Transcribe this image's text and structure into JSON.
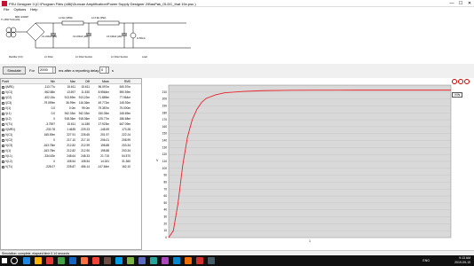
{
  "window": {
    "title": "PSU Designer II  (C:\\Program Files (x86)\\Duncan Amplification\\Power Supply Designer 2\\BasPak_OLDC_that 15x.psu )",
    "controls": [
      "—",
      "☐",
      "✕"
    ]
  },
  "menu": [
    "File",
    "Options",
    "Help"
  ],
  "schematic": {
    "transformer": "MR1 1N4007",
    "tx_label": "Tx 165V\n5.0A\n(2Ω)",
    "c1": "C1 220uF\n(2Ω)",
    "c2": "C2 220uF\n(2Ω)",
    "c3": "C3 440uF\n(2Ω)",
    "l1": "L1 6H (105Ω)",
    "l2": "L2 6.9H (35Ω)",
    "load": "I1\n65mA",
    "captions": [
      "Rectifier (0.0)",
      "LC Filter",
      "LC Filter Section",
      "LC Filter Section",
      "Load"
    ]
  },
  "toolbar": {
    "simulate": "Simulate",
    "for_label": "For",
    "for_value": "2000",
    "ms_label": "ms   after a reporting delay of",
    "delay_value": "0",
    "s_label": "s"
  },
  "table": {
    "headers": [
      "Plot/#",
      "Min",
      "Max",
      "Diff",
      "Mean",
      "RMS"
    ],
    "rows": [
      [
        "I(MR1)",
        "-113.77u",
        "15.611",
        "15.611",
        "96.097m",
        "540.97m"
      ],
      [
        "V(C1)",
        "-962.88n",
        "13.597",
        "11.530",
        "8.9564m",
        "590.59m"
      ],
      [
        "I(C2)",
        "-402.15u",
        "913.59m",
        "913.22m",
        "-71.889m",
        "77.964m"
      ],
      [
        "I(C3)",
        "-79.099m",
        "36.99m",
        "116.36m",
        "49.772m",
        "145.92m"
      ],
      [
        "V(1)",
        "0.0",
        "0.0m",
        "99.0m",
        "79.387m",
        "79.000m"
      ],
      [
        "I(L1)",
        "0.0",
        "942.33m",
        "942.33m",
        "150.05m",
        "245.69m"
      ],
      [
        "I(L2)",
        "0",
        "918.36m",
        "918.36m",
        "125.77m",
        "186.68m"
      ],
      [
        "V(T1)",
        "-3.7597",
        "15.611",
        "14.185",
        "17.923m",
        "647.09m"
      ],
      [
        "V(MR1)",
        "-230.78",
        "1.4635",
        "229.23",
        "-148.59",
        "173.28"
      ],
      [
        "V(C1)",
        "165.59m",
        "227.91",
        "226.65",
        "201.97",
        "222.24"
      ],
      [
        "V(C2)",
        "0",
        "217.10",
        "217.10",
        "206.01",
        "208.99"
      ],
      [
        "V(C3)",
        "-163.78m",
        "212.82",
        "212.99",
        "198.88",
        "203.34"
      ],
      [
        "V(1)",
        "-163.78m",
        "212.82",
        "212.90",
        "198.88",
        "203.34"
      ],
      [
        "V(L1)",
        "-334.63n",
        "248.64",
        "248.33",
        "21.715",
        "54.570"
      ],
      [
        "V(L2)",
        "0",
        "108.54",
        "108.54",
        "14.181",
        "31.360"
      ],
      [
        "V(T1)",
        "-228.07",
        "228.87",
        "456.14",
        "-147.84m",
        "162.10"
      ]
    ]
  },
  "chart_data": {
    "type": "line",
    "x": [
      0,
      5,
      10,
      15,
      20,
      25,
      30,
      35,
      40,
      50,
      60,
      80,
      100,
      130,
      160,
      200,
      250,
      300
    ],
    "series": [
      {
        "values": [
          0,
          10,
          50,
          105,
          145,
          170,
          185,
          195,
          201,
          206,
          209,
          211,
          212,
          212.5,
          212.7,
          212.8,
          212.8,
          212.8
        ],
        "color": "#e8232a"
      }
    ],
    "yticks": [
      "0",
      "10",
      "20",
      "30",
      "40",
      "50",
      "60",
      "70",
      "80",
      "90",
      "100",
      "110",
      "120",
      "130",
      "140",
      "150",
      "160",
      "170",
      "180",
      "190",
      "200",
      "210"
    ],
    "ylim": [
      0,
      220
    ],
    "grid": true,
    "ylabel": "V",
    "xtick_label": "1"
  },
  "chart": {
    "vbtn": "V/W",
    "zoom": [
      "zoom-in-icon",
      "zoom-out-icon",
      "zoom-fit-icon"
    ]
  },
  "status": "Simulation: complete, elapsed time 0.14 seconds",
  "taskbar": {
    "time": "9:13 AM",
    "date": "2019-09-19",
    "lang": "ENG",
    "icons": [
      "#1e88e5",
      "#ffb300",
      "#e53935",
      "#43a047",
      "#1565c0",
      "#ff7043",
      "#f44336",
      "#6d4c41",
      "#039be5",
      "#7cb342",
      "#5c6bc0",
      "#26a69a",
      "#ab47bc",
      "#0288d1",
      "#ef6c00",
      "#d32f2f",
      "#455a64"
    ]
  }
}
